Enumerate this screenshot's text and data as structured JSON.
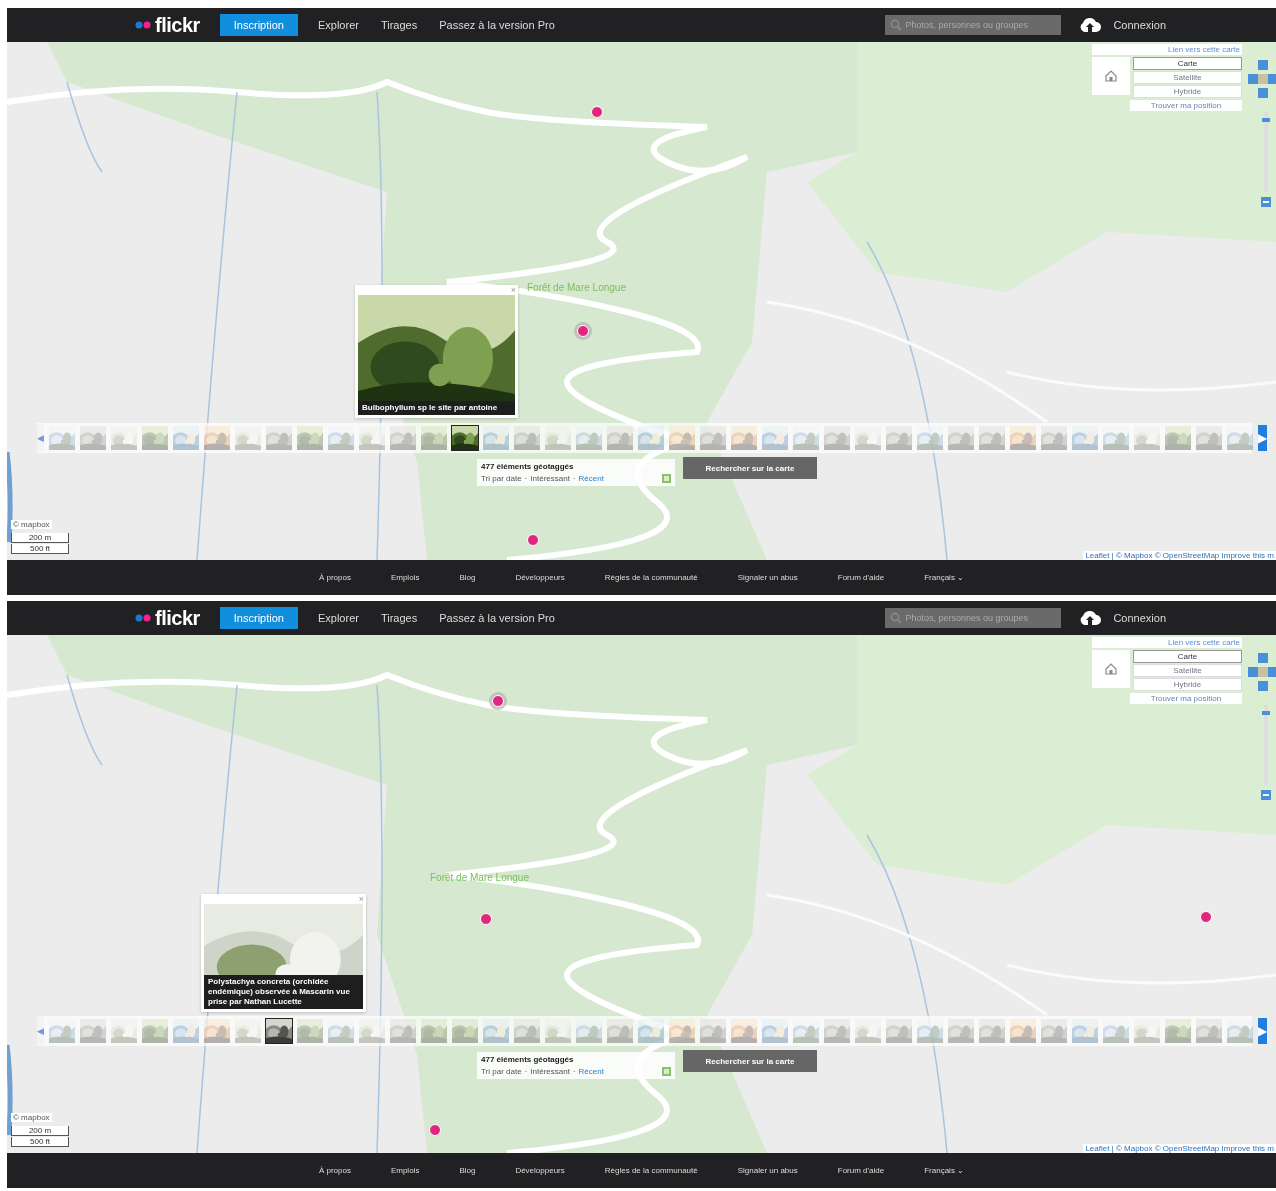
{
  "screens": [
    {
      "header": {
        "logo": "flickr",
        "signup": "Inscription",
        "nav": [
          "Explorer",
          "Tirages",
          "Passez à la version Pro"
        ],
        "search": {
          "placeholder": "Photos, personnes ou groupes"
        },
        "login": "Connexion"
      },
      "map": {
        "label": "Forêt de Mare Longue",
        "pins": [
          {
            "selected": false
          },
          {
            "selected": true
          },
          {
            "selected": false
          }
        ],
        "popup": {
          "caption": "Bulbophyllum sp le site par antoine",
          "close": "×"
        },
        "controls": {
          "link": "Lien vers cette carte",
          "types": [
            {
              "label": "Carte",
              "selected": true
            },
            {
              "label": "Satellite",
              "selected": false
            },
            {
              "label": "Hybride",
              "selected": false
            }
          ],
          "locate": "Trouver ma position",
          "zoom": {
            "level": 0.92
          }
        },
        "strip": {
          "prev": "◀",
          "next": "▶",
          "thumbnails": [
            {
              "selected": false
            },
            {
              "selected": false
            },
            {
              "selected": false
            },
            {
              "selected": false
            },
            {
              "selected": false
            },
            {
              "selected": false
            },
            {
              "selected": false
            },
            {
              "selected": false
            },
            {
              "selected": false
            },
            {
              "selected": false
            },
            {
              "selected": false
            },
            {
              "selected": false
            },
            {
              "selected": false
            },
            {
              "selected": true
            },
            {
              "selected": false
            },
            {
              "selected": false
            },
            {
              "selected": false
            },
            {
              "selected": false
            },
            {
              "selected": false
            },
            {
              "selected": false
            },
            {
              "selected": false
            },
            {
              "selected": false
            },
            {
              "selected": false
            },
            {
              "selected": false
            },
            {
              "selected": false
            },
            {
              "selected": false
            },
            {
              "selected": false
            },
            {
              "selected": false
            },
            {
              "selected": false
            },
            {
              "selected": false
            },
            {
              "selected": false
            },
            {
              "selected": false
            },
            {
              "selected": false
            },
            {
              "selected": false
            },
            {
              "selected": false
            },
            {
              "selected": false
            },
            {
              "selected": false
            },
            {
              "selected": false
            },
            {
              "selected": false
            }
          ]
        },
        "info": {
          "count": "477 éléments géotaggés",
          "sort_label": "Tri par date",
          "separator": "·",
          "sorts": [
            {
              "label": "Intéressant",
              "selected": true
            },
            {
              "label": "Récent",
              "selected": false
            }
          ],
          "search_button": "Rechercher sur la carte"
        },
        "scale": {
          "brand": "© mapbox",
          "metric": "200 m",
          "imperial": "500 ft"
        },
        "attribution": "Leaflet | © Mapbox © OpenStreetMap Improve this m"
      },
      "footer": [
        "À propos",
        "Emplois",
        "Blog",
        "Développeurs",
        "Règles de la communauté",
        "Signaler un abus",
        "Forum d'aide",
        "Français ⌄"
      ]
    },
    {
      "header": {
        "logo": "flickr",
        "signup": "Inscription",
        "nav": [
          "Explorer",
          "Tirages",
          "Passez à la version Pro"
        ],
        "search": {
          "placeholder": "Photos, personnes ou groupes"
        },
        "login": "Connexion"
      },
      "map": {
        "label": "Forêt de Mare Longue",
        "pins": [
          {
            "selected": true
          },
          {
            "selected": false
          },
          {
            "selected": false
          },
          {
            "selected": false
          }
        ],
        "popup": {
          "caption": "Polystachya concreta (orchidée endémique) observée à Mascarin vue prise par Nathan Lucette",
          "close": "×"
        },
        "controls": {
          "link": "Lien vers cette carte",
          "types": [
            {
              "label": "Carte",
              "selected": true
            },
            {
              "label": "Satellite",
              "selected": false
            },
            {
              "label": "Hybride",
              "selected": false
            }
          ],
          "locate": "Trouver ma position",
          "zoom": {
            "level": 0.92
          }
        },
        "strip": {
          "prev": "◀",
          "next": "▶",
          "thumbnails": [
            {
              "selected": false
            },
            {
              "selected": false
            },
            {
              "selected": false
            },
            {
              "selected": false
            },
            {
              "selected": false
            },
            {
              "selected": false
            },
            {
              "selected": false
            },
            {
              "selected": true
            },
            {
              "selected": false
            },
            {
              "selected": false
            },
            {
              "selected": false
            },
            {
              "selected": false
            },
            {
              "selected": false
            },
            {
              "selected": false
            },
            {
              "selected": false
            },
            {
              "selected": false
            },
            {
              "selected": false
            },
            {
              "selected": false
            },
            {
              "selected": false
            },
            {
              "selected": false
            },
            {
              "selected": false
            },
            {
              "selected": false
            },
            {
              "selected": false
            },
            {
              "selected": false
            },
            {
              "selected": false
            },
            {
              "selected": false
            },
            {
              "selected": false
            },
            {
              "selected": false
            },
            {
              "selected": false
            },
            {
              "selected": false
            },
            {
              "selected": false
            },
            {
              "selected": false
            },
            {
              "selected": false
            },
            {
              "selected": false
            },
            {
              "selected": false
            },
            {
              "selected": false
            },
            {
              "selected": false
            },
            {
              "selected": false
            },
            {
              "selected": false
            }
          ]
        },
        "info": {
          "count": "477 éléments géotaggés",
          "sort_label": "Tri par date",
          "separator": "·",
          "sorts": [
            {
              "label": "Intéressant",
              "selected": true
            },
            {
              "label": "Récent",
              "selected": false
            }
          ],
          "search_button": "Rechercher sur la carte"
        },
        "scale": {
          "brand": "© mapbox",
          "metric": "200 m",
          "imperial": "500 ft"
        },
        "attribution": "Leaflet | © Mapbox © OpenStreetMap Improve this m"
      },
      "footer": [
        "À propos",
        "Emplois",
        "Blog",
        "Développeurs",
        "Règles de la communauté",
        "Signaler un abus",
        "Forum d'aide",
        "Français ⌄"
      ]
    }
  ]
}
